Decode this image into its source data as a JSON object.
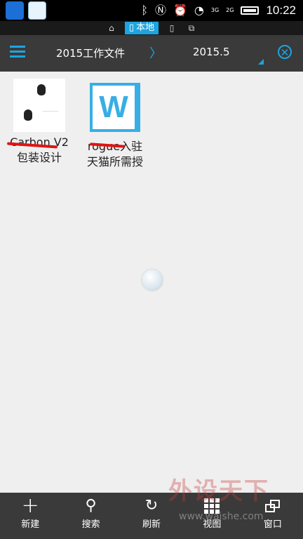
{
  "status": {
    "time": "10:22",
    "net1": "3G",
    "net2": "1X",
    "net3": "2G"
  },
  "storage_tabs": {
    "local_label": "本地"
  },
  "header": {
    "crumb_parent": "2015工作文件",
    "crumb_separator": "〉",
    "crumb_current": "2015.5"
  },
  "files": [
    {
      "name_line1": "Carbon V2",
      "name_line2": "包装设计"
    },
    {
      "name_line1": "rogue入驻",
      "name_line2": "天猫所需授"
    }
  ],
  "toolbar": {
    "new_label": "新建",
    "search_label": "搜索",
    "refresh_label": "刷新",
    "view_label": "视图",
    "window_label": "窗口"
  },
  "watermark": {
    "text": "外设天下",
    "url": "www.waishe.com"
  },
  "colors": {
    "accent": "#1ca5e0",
    "bar": "#3a3a3a",
    "background": "#efefef"
  }
}
